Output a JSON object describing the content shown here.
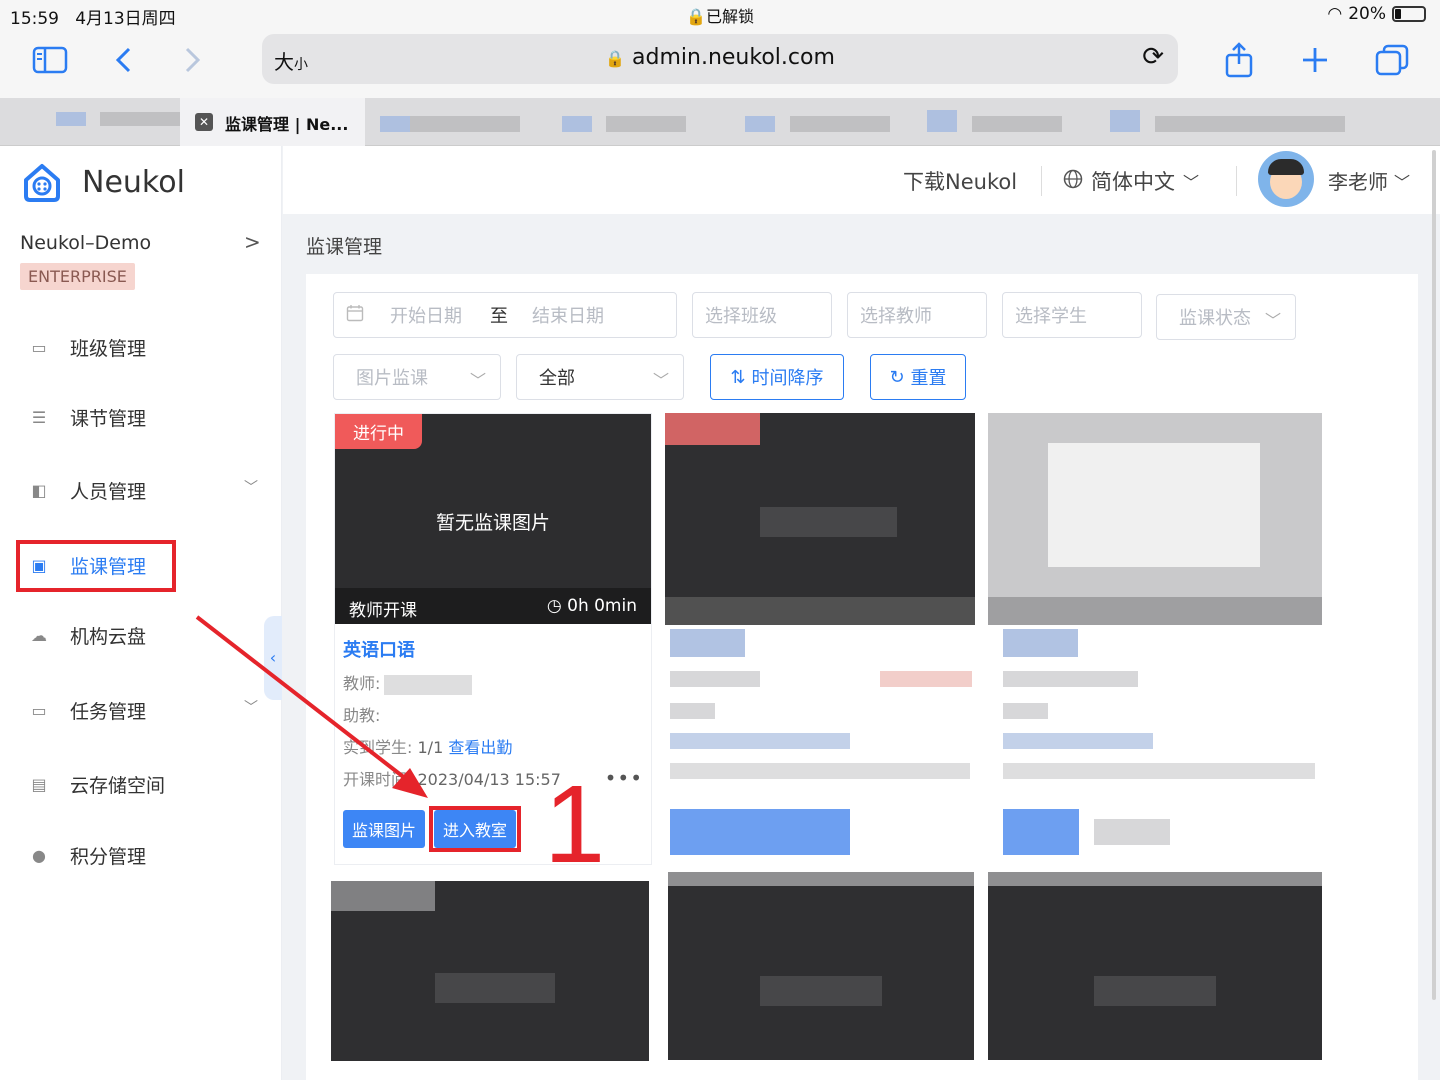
{
  "status_bar": {
    "time": "15:59",
    "date": "4月13日周四",
    "lock_text": "已解锁",
    "battery": "20%",
    "battery_level": 0.2
  },
  "browser": {
    "text_size_big": "大",
    "text_size_small": "小",
    "url": "admin.neukol.com",
    "active_tab_title": "监课管理 | Ne...",
    "icons": [
      "sidebar-icon",
      "back-icon",
      "forward-icon",
      "lock-icon",
      "reload-icon",
      "share-icon",
      "add-tab-icon",
      "tabs-icon"
    ]
  },
  "app": {
    "logo_name": "Neukol",
    "org_name": "Neukol–Demo",
    "org_badge": "ENTERPRISE",
    "nav": [
      {
        "label": "班级管理",
        "icon": "class-icon",
        "expand": false
      },
      {
        "label": "课节管理",
        "icon": "lesson-icon",
        "expand": false
      },
      {
        "label": "人员管理",
        "icon": "people-icon",
        "expand": true
      },
      {
        "label": "监课管理",
        "icon": "monitor-icon",
        "expand": false,
        "active": true
      },
      {
        "label": "机构云盘",
        "icon": "cloud-icon",
        "expand": false
      },
      {
        "label": "任务管理",
        "icon": "task-icon",
        "expand": true
      },
      {
        "label": "云存储空间",
        "icon": "storage-icon",
        "expand": false
      },
      {
        "label": "积分管理",
        "icon": "points-icon",
        "expand": false
      }
    ],
    "header": {
      "download": "下载Neukol",
      "language": "简体中文",
      "user": "李老师"
    },
    "breadcrumb": "监课管理",
    "filters": {
      "start_date": "开始日期",
      "to": "至",
      "end_date": "结束日期",
      "class": "选择班级",
      "teacher": "选择教师",
      "student": "选择学生",
      "status": "监课状态",
      "mode": "图片监课",
      "scope": "全部",
      "sort": "时间降序",
      "reset": "重置"
    },
    "card": {
      "status_tag": "进行中",
      "no_image": "暂无监课图片",
      "teacher_started": "教师开课",
      "duration": "0h 0min",
      "course_name": "英语口语",
      "teacher_label": "教师:",
      "assistant_label": "助教:",
      "attendance_label": "实到学生:",
      "attendance_value": "1/1",
      "attendance_link": "查看出勤",
      "start_label": "开课时间:",
      "start_time": "2023/04/13 15:57",
      "btn_images": "监课图片",
      "btn_enter": "进入教室"
    },
    "annotation_number": "1",
    "accent_color": "#2b7cf2",
    "annotation_color": "#e5242b"
  }
}
